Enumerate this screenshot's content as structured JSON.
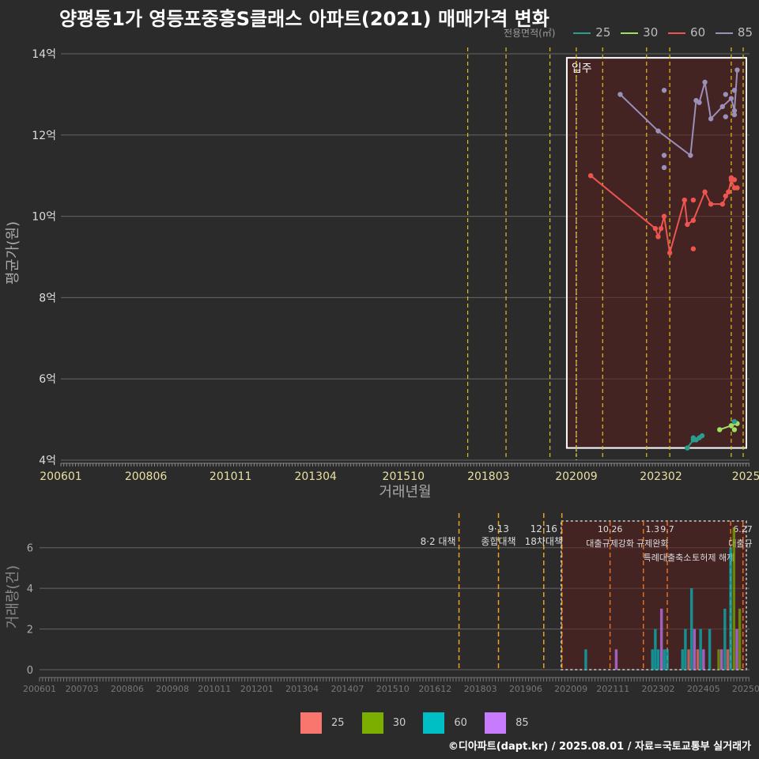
{
  "title": "양평동1가 영등포중흥S클래스 아파트(2021) 매매가격 변화",
  "credit": "©디아파트(dapt.kr) / 2025.08.01 / 자료=국토교통부 실거래가",
  "legend_top": {
    "title": "전용면적(㎡)",
    "items": [
      {
        "label": "25",
        "color": "#2a9d8f"
      },
      {
        "label": "30",
        "color": "#a0e060"
      },
      {
        "label": "60",
        "color": "#ee5550"
      },
      {
        "label": "85",
        "color": "#9a90b8"
      }
    ]
  },
  "legend_bottom": {
    "items": [
      {
        "label": "25",
        "color": "#f8766d"
      },
      {
        "label": "30",
        "color": "#7cae00"
      },
      {
        "label": "60",
        "color": "#00bfc4"
      },
      {
        "label": "85",
        "color": "#c77cff"
      }
    ]
  },
  "chart_data": [
    {
      "type": "line",
      "ylabel": "평균가(원)",
      "xlabel": "거래년월",
      "xlim": [
        2006.0,
        2025.6
      ],
      "ylim": [
        4,
        14
      ],
      "y_ticks": [
        {
          "v": 4,
          "label": "4억"
        },
        {
          "v": 6,
          "label": "6억"
        },
        {
          "v": 8,
          "label": "8억"
        },
        {
          "v": 10,
          "label": "10억"
        },
        {
          "v": 12,
          "label": "12억"
        },
        {
          "v": 14,
          "label": "14억"
        }
      ],
      "x_ticks": [
        {
          "v": 2006.0,
          "label": "200601"
        },
        {
          "v": 2008.42,
          "label": "200806"
        },
        {
          "v": 2010.83,
          "label": "201011"
        },
        {
          "v": 2013.25,
          "label": "201304"
        },
        {
          "v": 2015.75,
          "label": "201510"
        },
        {
          "v": 2018.17,
          "label": "201803"
        },
        {
          "v": 2020.67,
          "label": "202009"
        },
        {
          "v": 2023.08,
          "label": "202302"
        },
        {
          "v": 2025.5,
          "label": "2025"
        }
      ],
      "policy_lines": [
        2017.58,
        2018.67,
        2019.92,
        2020.67,
        2021.42,
        2022.67,
        2023.33,
        2025.08,
        2025.42
      ],
      "occupancy": {
        "label": "입주",
        "x": 2020.67,
        "x_range": [
          2020.4,
          2025.6
        ],
        "y_range": [
          4.3,
          13.9
        ]
      },
      "series": [
        {
          "name": "85",
          "color": "#9a90b8",
          "points": [
            [
              2021.92,
              13.0
            ],
            [
              2023.0,
              12.1
            ],
            [
              2023.92,
              11.5
            ],
            [
              2024.08,
              12.85
            ],
            [
              2024.17,
              12.8
            ],
            [
              2024.33,
              13.3
            ],
            [
              2024.5,
              12.4
            ],
            [
              2024.83,
              12.7
            ],
            [
              2025.08,
              12.9
            ],
            [
              2025.17,
              12.6
            ],
            [
              2025.25,
              13.6
            ]
          ],
          "extra": [
            [
              2023.17,
              13.1
            ],
            [
              2023.17,
              11.5
            ],
            [
              2023.17,
              11.2
            ],
            [
              2024.92,
              13.0
            ],
            [
              2024.92,
              12.45
            ],
            [
              2025.17,
              13.1
            ],
            [
              2025.17,
              12.5
            ]
          ]
        },
        {
          "name": "60",
          "color": "#ee5550",
          "points": [
            [
              2021.08,
              11.0
            ],
            [
              2022.92,
              9.7
            ],
            [
              2023.0,
              9.5
            ],
            [
              2023.08,
              9.7
            ],
            [
              2023.17,
              10.0
            ],
            [
              2023.33,
              9.1
            ],
            [
              2023.75,
              10.4
            ],
            [
              2023.83,
              9.8
            ],
            [
              2024.0,
              9.9
            ],
            [
              2024.33,
              10.6
            ],
            [
              2024.5,
              10.3
            ],
            [
              2024.83,
              10.3
            ],
            [
              2025.0,
              10.6
            ],
            [
              2025.08,
              10.9
            ],
            [
              2025.17,
              10.7
            ],
            [
              2025.25,
              10.7
            ]
          ],
          "extra": [
            [
              2024.0,
              10.4
            ],
            [
              2024.0,
              9.2
            ],
            [
              2024.92,
              10.5
            ],
            [
              2025.08,
              10.95
            ],
            [
              2025.17,
              10.9
            ]
          ]
        },
        {
          "name": "30",
          "color": "#a0e060",
          "points": [
            [
              2024.75,
              4.75
            ],
            [
              2025.08,
              4.85
            ],
            [
              2025.25,
              4.9
            ]
          ],
          "extra": [
            [
              2025.17,
              4.75
            ]
          ]
        },
        {
          "name": "25",
          "color": "#2a9d8f",
          "points": [
            [
              2023.83,
              4.3
            ],
            [
              2024.0,
              4.5
            ],
            [
              2024.08,
              4.5
            ],
            [
              2024.17,
              4.55
            ],
            [
              2024.25,
              4.6
            ]
          ],
          "extra": [
            [
              2024.0,
              4.55
            ],
            [
              2025.17,
              4.95
            ]
          ]
        }
      ]
    },
    {
      "type": "bar",
      "ylabel": "거래량(건)",
      "xlim": [
        2006.0,
        2025.6
      ],
      "ylim": [
        0,
        7
      ],
      "y_ticks": [
        {
          "v": 0,
          "label": "0"
        },
        {
          "v": 2,
          "label": "2"
        },
        {
          "v": 4,
          "label": "4"
        },
        {
          "v": 6,
          "label": "6"
        }
      ],
      "x_ticks": [
        {
          "v": 2006.0,
          "label": "200601"
        },
        {
          "v": 2007.17,
          "label": "200703"
        },
        {
          "v": 2008.42,
          "label": "200806"
        },
        {
          "v": 2009.67,
          "label": "200908"
        },
        {
          "v": 2010.83,
          "label": "201011"
        },
        {
          "v": 2012.0,
          "label": "201201"
        },
        {
          "v": 2013.25,
          "label": "201304"
        },
        {
          "v": 2014.5,
          "label": "201407"
        },
        {
          "v": 2015.75,
          "label": "201510"
        },
        {
          "v": 2016.92,
          "label": "201612"
        },
        {
          "v": 2018.17,
          "label": "201803"
        },
        {
          "v": 2019.42,
          "label": "201906"
        },
        {
          "v": 2020.67,
          "label": "202009"
        },
        {
          "v": 2021.83,
          "label": "202111"
        },
        {
          "v": 2023.08,
          "label": "202302"
        },
        {
          "v": 2024.33,
          "label": "202405"
        },
        {
          "v": 2025.5,
          "label": "20250"
        }
      ],
      "policy_lines": [
        2017.58,
        2018.67,
        2019.92,
        2020.42,
        2021.75,
        2022.67,
        2023.33,
        2025.08,
        2025.42
      ],
      "annotations": [
        {
          "x": 2017.58,
          "lines": [
            "",
            "8·2 대책"
          ],
          "anchor": "end"
        },
        {
          "x": 2018.67,
          "lines": [
            "9·13",
            "종합대책"
          ],
          "anchor": "middle"
        },
        {
          "x": 2019.92,
          "lines": [
            "12·16",
            "18차대책"
          ],
          "anchor": "middle"
        }
      ],
      "annotations2": [
        {
          "x": 2021.75,
          "lines": [
            "10.26",
            "대출규제강화"
          ],
          "anchor": "middle"
        },
        {
          "x": 2022.92,
          "lines": [
            "1.3",
            "규제완화"
          ],
          "anchor": "middle"
        },
        {
          "x": 2023.33,
          "lines": [
            "9.7",
            "특례대출축소"
          ],
          "anchor": "middle"
        },
        {
          "x": 2024.6,
          "lines": [
            "",
            "토허제 해제"
          ],
          "anchor": "middle"
        },
        {
          "x": 2025.42,
          "lines": [
            "6.27",
            "대출규"
          ],
          "anchor": "end"
        }
      ],
      "occupancy_range": [
        2020.4,
        2025.6
      ],
      "bars": [
        {
          "x": 2021.08,
          "h": 1,
          "s": "60"
        },
        {
          "x": 2021.92,
          "h": 1,
          "s": "85"
        },
        {
          "x": 2022.92,
          "h": 1,
          "s": "60"
        },
        {
          "x": 2023.0,
          "h": 2,
          "s": "60"
        },
        {
          "x": 2023.08,
          "h": 1,
          "s": "60"
        },
        {
          "x": 2023.17,
          "h": 3,
          "s": "85"
        },
        {
          "x": 2023.25,
          "h": 1,
          "s": "60"
        },
        {
          "x": 2023.33,
          "h": 1,
          "s": "60"
        },
        {
          "x": 2023.75,
          "h": 1,
          "s": "60"
        },
        {
          "x": 2023.83,
          "h": 2,
          "s": "60"
        },
        {
          "x": 2023.92,
          "h": 1,
          "s": "25"
        },
        {
          "x": 2024.0,
          "h": 4,
          "s": "60"
        },
        {
          "x": 2024.08,
          "h": 2,
          "s": "85"
        },
        {
          "x": 2024.17,
          "h": 1,
          "s": "25"
        },
        {
          "x": 2024.25,
          "h": 2,
          "s": "60"
        },
        {
          "x": 2024.33,
          "h": 1,
          "s": "85"
        },
        {
          "x": 2024.5,
          "h": 2,
          "s": "60"
        },
        {
          "x": 2024.75,
          "h": 1,
          "s": "30"
        },
        {
          "x": 2024.83,
          "h": 1,
          "s": "85"
        },
        {
          "x": 2024.92,
          "h": 3,
          "s": "60"
        },
        {
          "x": 2025.0,
          "h": 1,
          "s": "25"
        },
        {
          "x": 2025.08,
          "h": 6,
          "s": "60"
        },
        {
          "x": 2025.17,
          "h": 7,
          "s": "30"
        },
        {
          "x": 2025.25,
          "h": 2,
          "s": "85"
        },
        {
          "x": 2025.33,
          "h": 3,
          "s": "30"
        }
      ]
    }
  ]
}
